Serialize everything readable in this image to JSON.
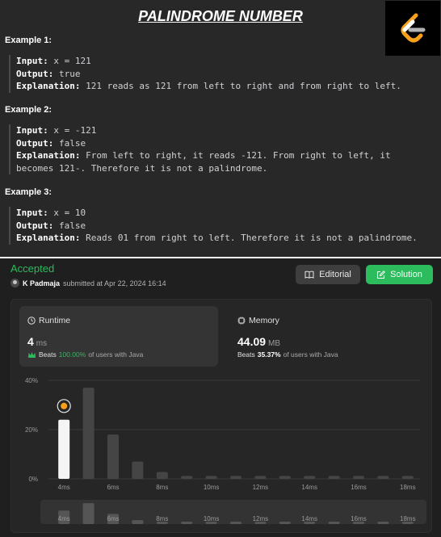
{
  "problem": {
    "title": "PALINDROME NUMBER",
    "examples": [
      {
        "heading": "Example 1:",
        "input_label": "Input:",
        "input": " x = 121",
        "output_label": "Output:",
        "output": " true",
        "explanation_label": "Explanation:",
        "explanation": " 121 reads as 121 from left to right and from right to left."
      },
      {
        "heading": "Example 2:",
        "input_label": "Input:",
        "input": " x = -121",
        "output_label": "Output:",
        "output": " false",
        "explanation_label": "Explanation:",
        "explanation": " From left to right, it reads -121. From right to left, it becomes 121-. Therefore it is not a palindrome."
      },
      {
        "heading": "Example 3:",
        "input_label": "Input:",
        "input": " x = 10",
        "output_label": "Output:",
        "output": " false",
        "explanation_label": "Explanation:",
        "explanation": " Reads 01 from right to left. Therefore it is not a palindrome."
      }
    ],
    "logo_icon": "leetcode-logo-icon",
    "logo_colors": {
      "orange": "#f89f1b",
      "gray": "#b3b3b3",
      "bg": "#000000"
    }
  },
  "submission": {
    "status": "Accepted",
    "status_color": "#2cbb5d",
    "user": "K Padmaja",
    "submitted_text": "submitted at Apr 22, 2024 16:14",
    "editorial_label": "Editorial",
    "solution_label": "Solution",
    "runtime": {
      "label": "Runtime",
      "value": "4",
      "unit": "ms",
      "beats_label": "Beats",
      "beats_pct": "100.00%",
      "beats_suffix": "of users with Java"
    },
    "memory": {
      "label": "Memory",
      "value": "44.09",
      "unit": "MB",
      "beats_label": "Beats",
      "beats_pct": "35.37%",
      "beats_suffix": "of users with Java"
    }
  },
  "chart_data": {
    "type": "bar",
    "title": "",
    "xlabel": "",
    "ylabel": "",
    "ylim": [
      0,
      40
    ],
    "yticks": [
      "40%",
      "20%",
      "0%"
    ],
    "ytick_values": [
      40,
      20,
      0
    ],
    "categories": [
      "4ms",
      "5ms",
      "6ms",
      "7ms",
      "8ms",
      "9ms",
      "10ms",
      "11ms",
      "12ms",
      "13ms",
      "14ms",
      "15ms",
      "16ms",
      "17ms",
      "18ms"
    ],
    "xtick_labels": [
      "4ms",
      "6ms",
      "8ms",
      "10ms",
      "12ms",
      "14ms",
      "16ms",
      "18ms"
    ],
    "values": [
      24,
      37,
      18,
      7,
      2.8,
      1.2,
      1.2,
      1.2,
      1.2,
      1.2,
      1.2,
      1.2,
      1.2,
      1.2,
      1.2
    ],
    "highlight_index": 0,
    "colors": {
      "highlight": "#f5f5f5",
      "bar": "#454545",
      "grid": "#3a3a3a",
      "mini_bar": "#555555"
    }
  }
}
